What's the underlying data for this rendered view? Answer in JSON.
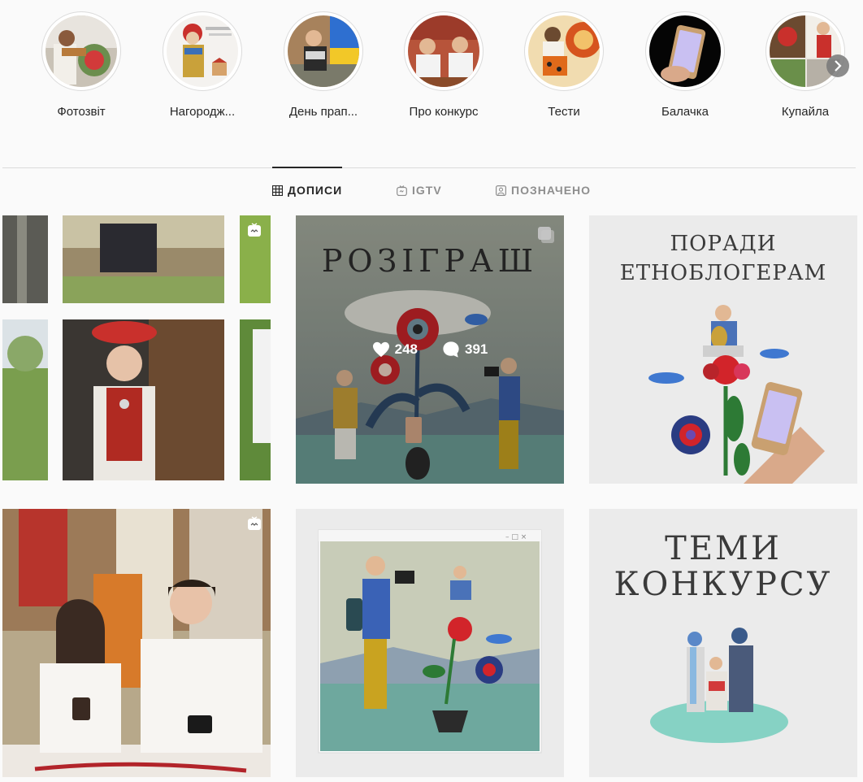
{
  "highlights": [
    {
      "label": "Фотозвіт",
      "icon": "photo-report-thumbnail"
    },
    {
      "label": "Нагородж...",
      "icon": "award-thumbnail"
    },
    {
      "label": "День прап...",
      "icon": "flag-day-thumbnail"
    },
    {
      "label": "Про конкурс",
      "icon": "about-contest-thumbnail"
    },
    {
      "label": "Тести",
      "icon": "tests-thumbnail"
    },
    {
      "label": "Балачка",
      "icon": "chat-thumbnail"
    },
    {
      "label": "Купайла",
      "icon": "kupala-thumbnail"
    }
  ],
  "tabs": [
    {
      "label": "ДОПИСИ",
      "icon": "grid-icon",
      "active": true
    },
    {
      "label": "IGTV",
      "icon": "igtv-icon",
      "active": false
    },
    {
      "label": "ПОЗНАЧЕНО",
      "icon": "tagged-icon",
      "active": false
    }
  ],
  "posts": {
    "giveaway": {
      "title": "РОЗІГРАШ",
      "likes": "248",
      "comments": "391"
    },
    "tips": {
      "title_line1": "ПОРАДИ",
      "title_line2": "ЕТНОБЛОГЕРАМ"
    },
    "themes": {
      "title_line1": "ТЕМИ",
      "title_line2": "КОНКУРСУ"
    }
  },
  "colors": {
    "background": "#fafafa",
    "border": "#dbdbdb",
    "text": "#262626",
    "muted": "#8e8e8e"
  }
}
